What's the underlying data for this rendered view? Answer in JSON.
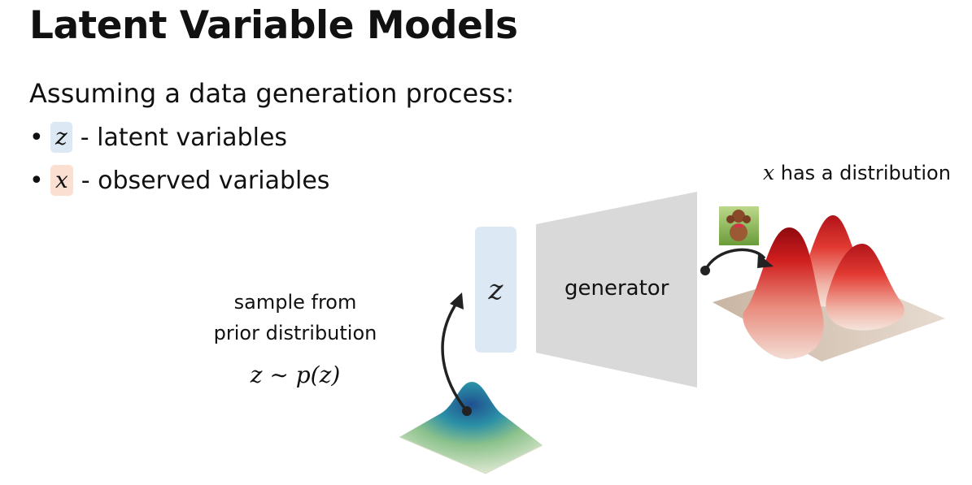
{
  "slide": {
    "title": "Latent Variable Models",
    "intro": "Assuming a data generation process:",
    "bullets": [
      {
        "symbol": "z",
        "text": "- latent variables"
      },
      {
        "symbol": "x",
        "text": "- observed variables"
      }
    ]
  },
  "diagram": {
    "prior_caption_line1": "sample from",
    "prior_caption_line2": "prior distribution",
    "prior_formula": "z ∼ p(z)",
    "latent_box_label": "z",
    "generator_label": "generator",
    "output_caption_symbol": "x",
    "output_caption_text": "has a distribution"
  },
  "colors": {
    "latent_highlight": "#dce8f4",
    "observed_highlight": "#fbe0d2",
    "generator_fill": "#d9d9d9",
    "prior_peak": "#1f5fa3",
    "prior_base": "#e6ebd6",
    "output_peak": "#c0141b",
    "output_base": "#d8c7b8"
  },
  "icons": [
    "bullet-dot-icon",
    "dog-photo-thumbnail",
    "curved-arrow-icon"
  ]
}
